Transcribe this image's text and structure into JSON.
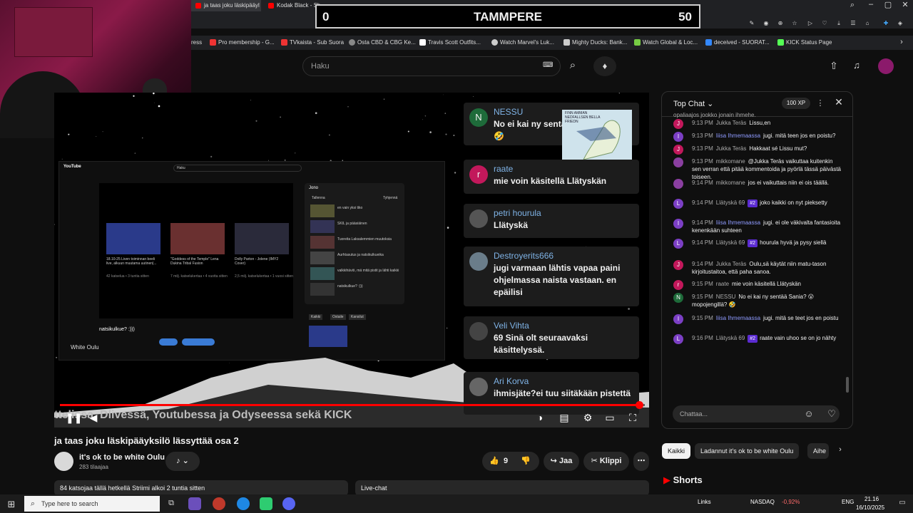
{
  "browser": {
    "tabs": [
      {
        "label": "ja taas joku läskipääyl",
        "color": "#ff0000"
      },
      {
        "label": "Kodak Black - Sh...",
        "color": "#ff0000"
      }
    ],
    "bookmarks": [
      {
        "label": "ress",
        "color": "#333333"
      },
      {
        "label": "Pro membership - G...",
        "color": "#e33"
      },
      {
        "label": "TVkaista - Sub Suora",
        "color": "#e33"
      },
      {
        "label": "Osta CBD & CBG Ke...",
        "color": "#888"
      },
      {
        "label": "Travis Scott Outfits...",
        "color": "#fff"
      },
      {
        "label": "Watch Marvel's Luk...",
        "color": "#fff"
      },
      {
        "label": "Mighty Ducks: Bank...",
        "color": "#fff"
      },
      {
        "label": "Watch Global & Loc...",
        "color": "#7c4"
      },
      {
        "label": "deceived - SUORAT...",
        "color": "#38f"
      },
      {
        "label": "KICK Status Page",
        "color": "#5f5"
      }
    ]
  },
  "youtube": {
    "search_placeholder": "Haku"
  },
  "scoreboard": {
    "left_score": "0",
    "city": "TAMMPERE",
    "right_score": "50"
  },
  "video": {
    "ticker": "ttelissa, Dlivessä, Youtubessa ja Odyseessa sekä KICK",
    "progress": 0.99,
    "inner": {
      "logo": "YouTube",
      "search": "Haku",
      "queue_title": "Jono",
      "queue_sub": "Tallenna",
      "queue_clear": "Tyhjennä",
      "video_title": "natsikulkue? :)))",
      "channel": "White Oulu",
      "thumbs": [
        {
          "title": "18.10-25 Liven toiminnan beeli live, alkuun muutama uutinen|...",
          "meta": "42 katselua • 3 tuntia sitten"
        },
        {
          "title": "\"Goddess of the Temple\" Lena Dukina Tribal Fusion",
          "meta": "7 milj. katselukertaa • 4 vuotta sitten"
        },
        {
          "title": "Dolly Parton - Jolene (IMY2 Cover)",
          "meta": "2,5 milj. katselukertaa • 1 vuosi sitten"
        }
      ],
      "queue_items": [
        "en vain yksi tiko",
        "SKIL ja pääsiäinen",
        "Tuoreita Laksalemmien muutoksia",
        "Aurhtasutus ja natsikulkueika",
        "valkkihäviö, mä mitä pistit ja lähti kaikki",
        "natsikulkue? :)))"
      ],
      "filters": [
        "Kaikki",
        "Ostaile",
        "Kansilut"
      ]
    },
    "chat_overlay": [
      {
        "name": "NESSU",
        "text": "No ei kai ny sentä mopojengillä? 🤣",
        "avatar": "N",
        "color": "#1e6b3a"
      },
      {
        "name": "raate",
        "text": "mie voin käsitellä Llätyskän",
        "avatar": "r",
        "color": "#c2185b"
      },
      {
        "name": "petri hourula",
        "text": "Llätyskä",
        "avatar": "",
        "color": "#555"
      },
      {
        "name": "Destroyerits666",
        "text": "jugi varmaan lähtis vapaa paini ohjelmassa naista vastaan. en epäilisi",
        "avatar": "",
        "color": "#6a7d8a"
      },
      {
        "name": "Veli Vihta",
        "text": "69 Sinä olt seuraavaksi käsittelyssä.",
        "avatar": "",
        "color": "#444"
      },
      {
        "name": "Ari Korva",
        "text": "ihmisjäte?ei tuu siitäkään pistettä",
        "avatar": "",
        "color": "#666"
      }
    ],
    "map_label": "FINN AMMAN NEDFALLSEN BELLA FRIEDN"
  },
  "below_video": {
    "title": "ja taas joku läskipääyksilö lässyttää osa 2",
    "channel_name": "it's ok to be white Oulu",
    "subscribers": "283 tilaajaa",
    "likes": "9",
    "share": "Jaa",
    "clip": "Klippi",
    "description": "84 katsojaa tällä hetkellä Striimi alkoi 2 tuntia sitten",
    "live_chat": "Live-chat"
  },
  "chat_panel": {
    "title": "Top Chat",
    "xp": "100 XP",
    "top_fragment": "opaliaajos jookko jonain ihmehe.",
    "messages": [
      {
        "time": "9:13 PM",
        "author": "Jukka Teräs",
        "text": "Lissu,en",
        "avatar": "J",
        "color": "#c2185b",
        "mod": false,
        "badge": ""
      },
      {
        "time": "9:13 PM",
        "author": "Iiisa Ihmemaassa",
        "text": "jugi. mitä teen jos en poistu?",
        "avatar": "I",
        "color": "#7b3fc4",
        "mod": true,
        "badge": ""
      },
      {
        "time": "9:13 PM",
        "author": "Jukka Teräs",
        "text": "Hakkaat sé Lissu mut?",
        "avatar": "J",
        "color": "#c2185b",
        "mod": false,
        "badge": ""
      },
      {
        "time": "9:13 PM",
        "author": "mikkomane",
        "text": "@Jukka Teräs vaikuttaa kuitenkin sen verran että pitää kommentoida ja pyörlä tässä päivästä toiseen.",
        "avatar": "",
        "color": "#8a3fa0",
        "mod": false,
        "badge": ""
      },
      {
        "time": "9:14 PM",
        "author": "mikkomane",
        "text": "jos ei vaikuttais niin ei ois täällä.",
        "avatar": "",
        "color": "#8a3fa0",
        "mod": false,
        "badge": ""
      },
      {
        "time": "9:14 PM",
        "author": "Llätyskä 69",
        "text": "joko kaikki on nyt pieksetty",
        "avatar": "L",
        "color": "#7b3fc4",
        "mod": false,
        "badge": "#2"
      },
      {
        "time": "9:14 PM",
        "author": "Iiisa Ihmemaassa",
        "text": "jugi. ei ole väkivalta fantasioita kenenkään suhteen",
        "avatar": "I",
        "color": "#7b3fc4",
        "mod": true,
        "badge": ""
      },
      {
        "time": "9:14 PM",
        "author": "Llätyskä 69",
        "text": "hourula hyvä ja pysy siellä",
        "avatar": "L",
        "color": "#7b3fc4",
        "mod": false,
        "badge": "#2"
      },
      {
        "time": "9:14 PM",
        "author": "Jukka Teräs",
        "text": "Oulu,sä käytät niin matu-tason kirjoitustaitoa, että paha sanoa.",
        "avatar": "J",
        "color": "#c2185b",
        "mod": false,
        "badge": ""
      },
      {
        "time": "9:15 PM",
        "author": "raate",
        "text": "mie voin käsitellä Llätyskän",
        "avatar": "r",
        "color": "#c2185b",
        "mod": false,
        "badge": ""
      },
      {
        "time": "9:15 PM",
        "author": "NESSU",
        "text": "No ei kai ny sentää Sania? 😮 mopojengillä? 🤣",
        "avatar": "N",
        "color": "#1e6b3a",
        "mod": false,
        "badge": ""
      },
      {
        "time": "9:15 PM",
        "author": "Iiisa Ihmemaassa",
        "text": "jugi. mitä se teet jos en poistu",
        "avatar": "I",
        "color": "#7b3fc4",
        "mod": true,
        "badge": ""
      },
      {
        "time": "9:16 PM",
        "author": "Llätyskä 69",
        "text": "raate vain uhoo se on jo nähty",
        "avatar": "L",
        "color": "#7b3fc4",
        "mod": false,
        "badge": "#2"
      }
    ],
    "input_placeholder": "Chattaa...",
    "chips": [
      "Kaikki",
      "Ladannut it's ok to be white Oulu",
      "Aihe"
    ],
    "shorts": "Shorts"
  },
  "taskbar": {
    "search_placeholder": "Type here to search",
    "links": "Links",
    "nasdaq": "NASDAQ",
    "nasdaq_change": "-0,92%",
    "lang": "ENG",
    "time": "21.16",
    "date": "16/10/2025"
  }
}
